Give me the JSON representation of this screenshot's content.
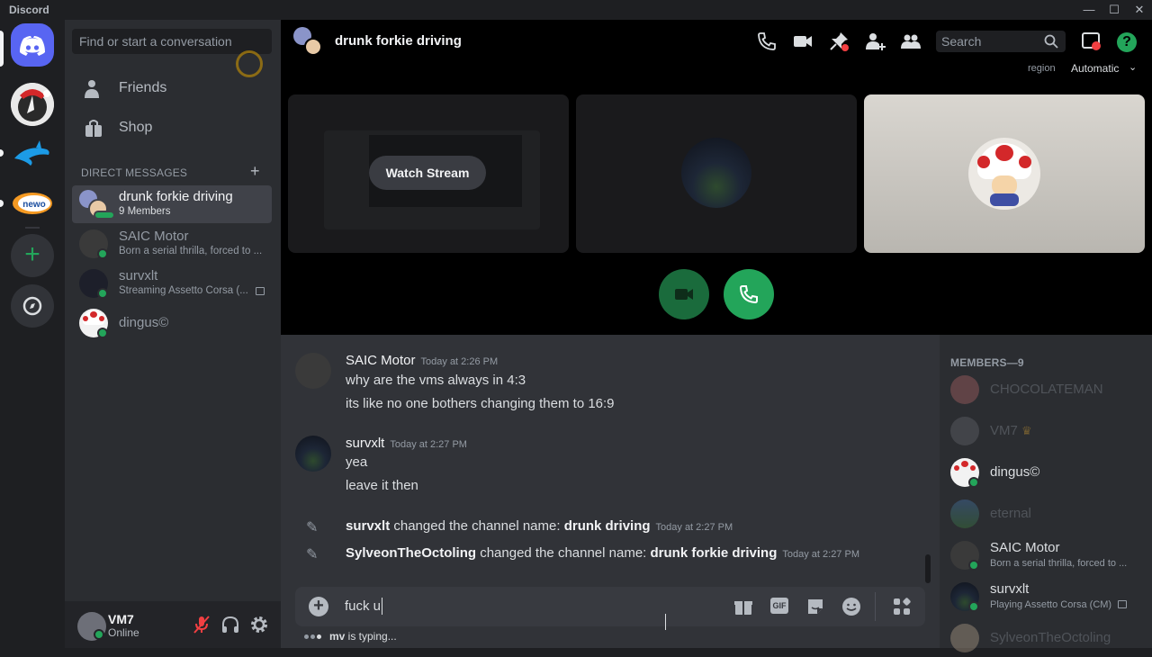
{
  "app": {
    "title": "Discord"
  },
  "window": {
    "minimize": "—",
    "maximize": "☐",
    "close": "✕"
  },
  "rail": {
    "servers": [
      {
        "name": "home",
        "icon": "discord-icon"
      },
      {
        "name": "server-1",
        "icon": "server-avatar"
      },
      {
        "name": "server-2",
        "icon": "dolphin-icon"
      },
      {
        "name": "server-3",
        "icon": "newo-logo"
      }
    ],
    "add_label": "+",
    "explore_icon": "compass-icon"
  },
  "dm_sidebar": {
    "search_placeholder": "Find or start a conversation",
    "nav": [
      {
        "label": "Friends",
        "icon": "friends-icon"
      },
      {
        "label": "Shop",
        "icon": "shop-icon"
      }
    ],
    "section_title": "DIRECT MESSAGES",
    "add_dm": "+",
    "dms": [
      {
        "name": "drunk forkie driving",
        "sub": "9 Members",
        "selected": true
      },
      {
        "name": "SAIC Motor",
        "sub": "Born a serial thrilla, forced to ..."
      },
      {
        "name": "survxlt",
        "sub": "Streaming Assetto Corsa (..."
      },
      {
        "name": "dingus©",
        "sub": ""
      }
    ]
  },
  "user_panel": {
    "name": "VM7",
    "status": "Online"
  },
  "call": {
    "channel_name": "drunk forkie driving",
    "search_placeholder": "Search",
    "region_label": "region",
    "region_value": "Automatic",
    "watch_stream": "Watch Stream",
    "colors": {
      "green": "#23a55a",
      "dark_green": "#1a6b3c"
    }
  },
  "messages": [
    {
      "author": "SAIC Motor",
      "time": "Today at 2:26 PM",
      "lines": [
        "why are the vms always in 4:3",
        "its like no one bothers changing them to 16:9"
      ]
    },
    {
      "author": "survxlt",
      "time": "Today at 2:27 PM",
      "lines": [
        "yea",
        "leave it then"
      ]
    }
  ],
  "system_messages": [
    {
      "actor": "survxlt",
      "text": " changed the channel name: ",
      "value": "drunk driving",
      "time": "Today at 2:27 PM"
    },
    {
      "actor": "SylveonTheOctoling",
      "text": " changed the channel name: ",
      "value": "drunk forkie driving",
      "time": "Today at 2:27 PM"
    }
  ],
  "composer": {
    "value": "fuck u",
    "gif": "GIF"
  },
  "typing": {
    "user": "mv",
    "text": " is typing..."
  },
  "members": {
    "title": "MEMBERS—9",
    "list": [
      {
        "name": "CHOCOLATEMAN",
        "sub": "",
        "online": false
      },
      {
        "name": "VM7",
        "sub": "",
        "online": false,
        "crown": "♛"
      },
      {
        "name": "dingus©",
        "sub": "",
        "online": true
      },
      {
        "name": "eternal",
        "sub": "",
        "online": false
      },
      {
        "name": "SAIC Motor",
        "sub": "Born a serial thrilla, forced to ...",
        "online": true
      },
      {
        "name": "survxlt",
        "sub": "Playing Assetto Corsa (CM)",
        "online": true
      },
      {
        "name": "SylveonTheOctoling",
        "sub": "",
        "online": false
      }
    ]
  }
}
